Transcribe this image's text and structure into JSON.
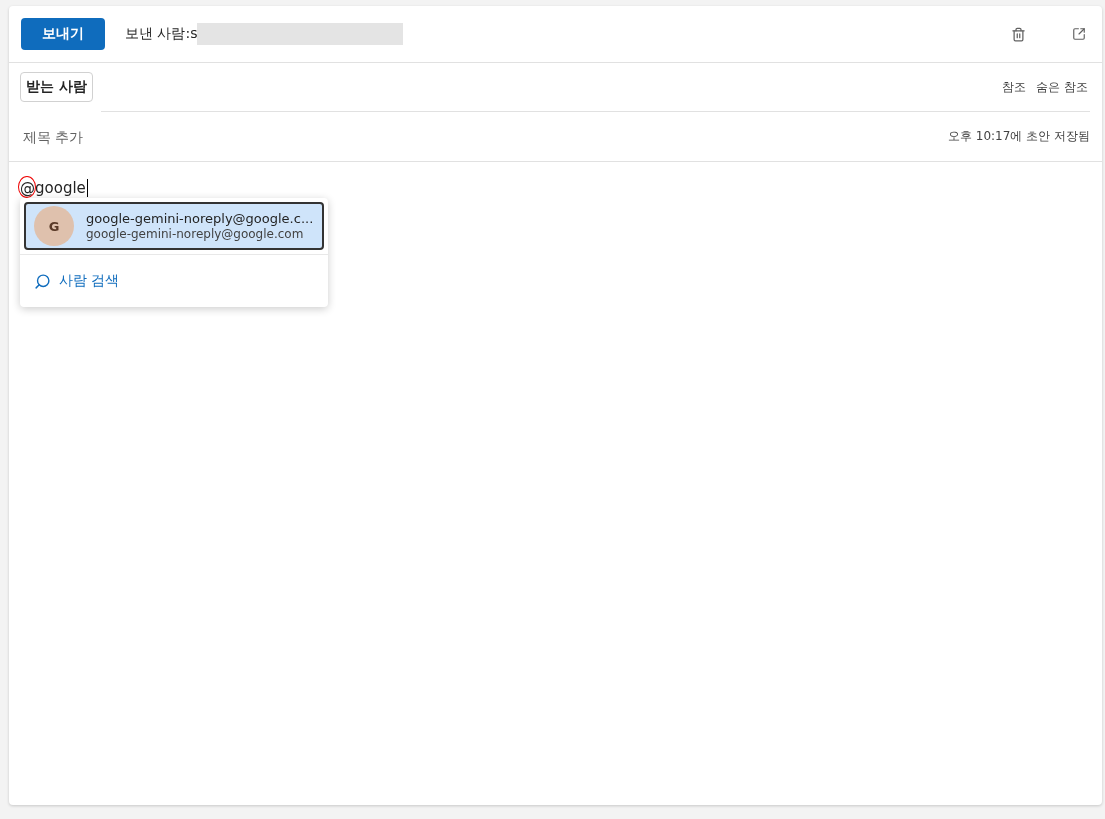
{
  "header": {
    "send_button": "보내기",
    "from_label": "보낸 사람:s"
  },
  "to": {
    "label": "받는 사람",
    "cc": "참조",
    "bcc": "숨은 참조"
  },
  "subject": {
    "placeholder": "제목 추가",
    "saved_status": "오후 10:17에 초안 저장됨"
  },
  "body": {
    "text": "@google",
    "spelling_mark": true
  },
  "suggestions": {
    "items": [
      {
        "initial": "G",
        "name": "google-gemini-noreply@google.c...",
        "email": "google-gemini-noreply@google.com",
        "selected": true
      }
    ],
    "search_people": "사람 검색"
  }
}
